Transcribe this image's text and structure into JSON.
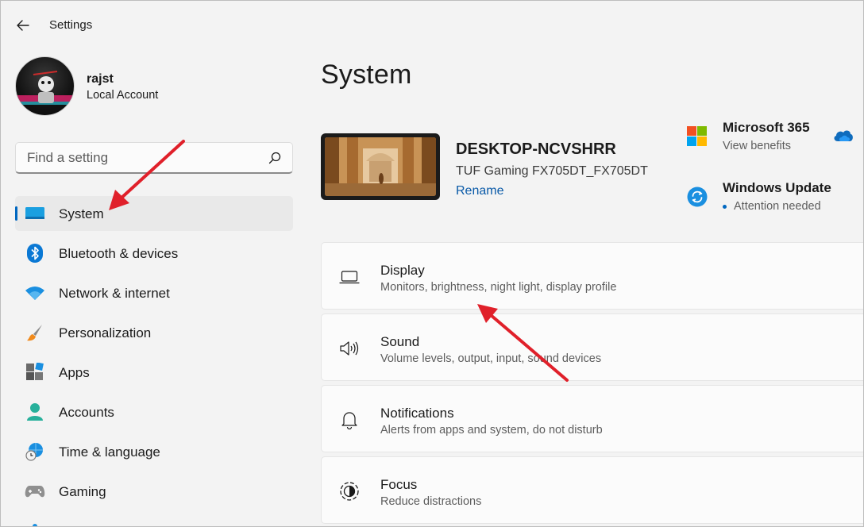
{
  "window": {
    "title": "Settings"
  },
  "profile": {
    "name": "rajst",
    "account_type": "Local Account"
  },
  "search": {
    "placeholder": "Find a setting",
    "value": ""
  },
  "nav": {
    "items": [
      {
        "label": "System",
        "icon": "system-display-icon",
        "active": true
      },
      {
        "label": "Bluetooth & devices",
        "icon": "bluetooth-icon",
        "active": false
      },
      {
        "label": "Network & internet",
        "icon": "wifi-icon",
        "active": false
      },
      {
        "label": "Personalization",
        "icon": "paintbrush-icon",
        "active": false
      },
      {
        "label": "Apps",
        "icon": "apps-icon",
        "active": false
      },
      {
        "label": "Accounts",
        "icon": "accounts-icon",
        "active": false
      },
      {
        "label": "Time & language",
        "icon": "globe-clock-icon",
        "active": false
      },
      {
        "label": "Gaming",
        "icon": "gamepad-icon",
        "active": false
      }
    ]
  },
  "main": {
    "title": "System",
    "device": {
      "name": "DESKTOP-NCVSHRR",
      "model": "TUF Gaming FX705DT_FX705DT",
      "rename_label": "Rename"
    },
    "promos": [
      {
        "title": "Microsoft 365",
        "subtitle": "View benefits",
        "icon": "microsoft-logo-icon"
      },
      {
        "title": "Windows Update",
        "subtitle": "Attention needed",
        "icon": "windows-update-icon"
      }
    ],
    "settings": [
      {
        "title": "Display",
        "description": "Monitors, brightness, night light, display profile",
        "icon": "laptop-display-icon"
      },
      {
        "title": "Sound",
        "description": "Volume levels, output, input, sound devices",
        "icon": "speaker-icon"
      },
      {
        "title": "Notifications",
        "description": "Alerts from apps and system, do not disturb",
        "icon": "bell-icon"
      },
      {
        "title": "Focus",
        "description": "Reduce distractions",
        "icon": "focus-icon"
      }
    ]
  },
  "colors": {
    "accent": "#0067c0",
    "annotation_arrow": "#e0202a",
    "link": "#0a5aa8"
  }
}
